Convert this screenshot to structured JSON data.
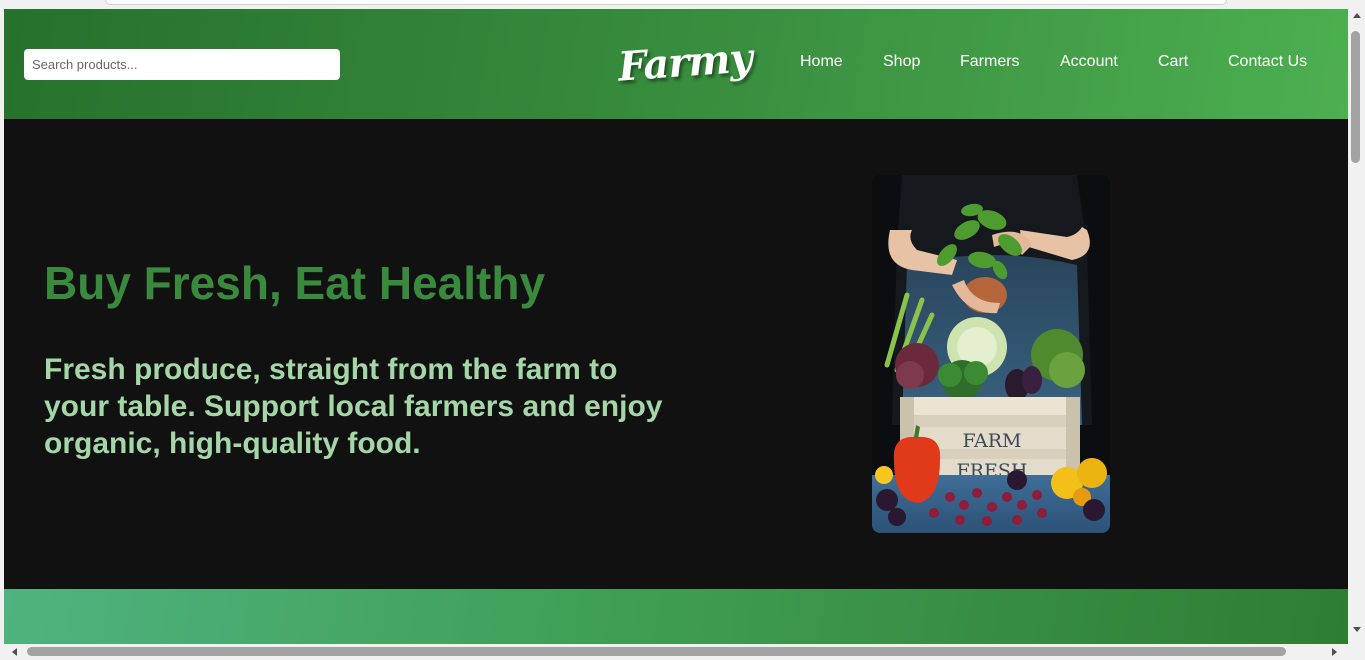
{
  "search": {
    "placeholder": "Search products..."
  },
  "brand": {
    "name": "Farmy"
  },
  "nav": {
    "items": [
      {
        "label": "Home"
      },
      {
        "label": "Shop"
      },
      {
        "label": "Farmers"
      },
      {
        "label": "Account"
      },
      {
        "label": "Cart"
      },
      {
        "label": "Contact Us"
      }
    ]
  },
  "hero": {
    "title": "Buy Fresh, Eat Healthy",
    "subtitle": "Fresh produce, straight from the farm to your table. Support local farmers and enjoy organic, high-quality food.",
    "image": {
      "crate_text_1": "FARM",
      "crate_text_2": "FRESH"
    }
  },
  "colors": {
    "header_start": "#26712c",
    "header_end": "#4caf50",
    "hero_bg": "#111111",
    "title": "#3a8a3e",
    "subtitle": "#a5d6a7"
  }
}
